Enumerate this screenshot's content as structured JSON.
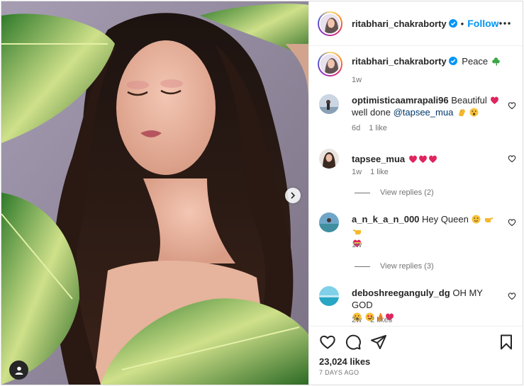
{
  "post": {
    "author": "ritabhari_chakraborty",
    "follow_label": "Follow",
    "separator": "•",
    "caption_text": "Peace",
    "caption_age": "1w",
    "likes": "23,024 likes",
    "posted": "7 DAYS AGO"
  },
  "comments": [
    {
      "user": "optimisticaamrapali96",
      "text": "Beautiful",
      "text_2": "well done",
      "mention": "@tapsee_mua",
      "age": "6d",
      "likes": "1 like"
    },
    {
      "user": "tapsee_mua",
      "age": "1w",
      "likes": "1 like",
      "view_replies": "View replies (2)"
    },
    {
      "user": "a_n_k_a_n_000",
      "text": "Hey Queen",
      "age": "1w",
      "view_replies": "View replies (3)"
    },
    {
      "user": "deboshreeganguly_dg",
      "text": "OH MY GOD",
      "age": "2w",
      "likes": "2 likes"
    }
  ],
  "icons": {
    "verified": "verified-badge-icon",
    "more": "more-options-icon",
    "next": "chevron-right-icon",
    "tag": "user-tag-icon",
    "like": "heart-icon",
    "comment": "comment-icon",
    "share": "send-icon",
    "save": "bookmark-icon"
  },
  "colors": {
    "accent": "#0095f6",
    "verified": "#0095f6",
    "text": "#262626",
    "muted": "#737373",
    "heart_emoji": "#e0245e"
  }
}
